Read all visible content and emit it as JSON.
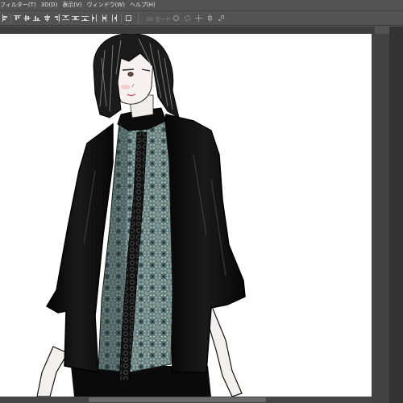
{
  "menubar": {
    "items": [
      {
        "label": "フィルター(T)"
      },
      {
        "label": "3D(D)"
      },
      {
        "label": "表示(V)"
      },
      {
        "label": "ウィンドウ(W)"
      },
      {
        "label": "ヘルプ(H)"
      }
    ]
  },
  "optionsbar": {
    "mode3d_label": "3D モード :"
  },
  "icons": {
    "align": "align-icon",
    "distribute": "distribute-icon",
    "orbit3d": "orbit-3d-icon",
    "roll3d": "roll-3d-icon",
    "pan3d": "pan-3d-icon",
    "slide3d": "slide-3d-icon",
    "scale3d": "scale-3d-icon"
  },
  "canvas": {
    "artwork": "illustration",
    "background_color": "#ffffff"
  },
  "colors": {
    "ui_dark": "#535353",
    "panel": "#333333",
    "menu_text": "#e8e8e8"
  }
}
